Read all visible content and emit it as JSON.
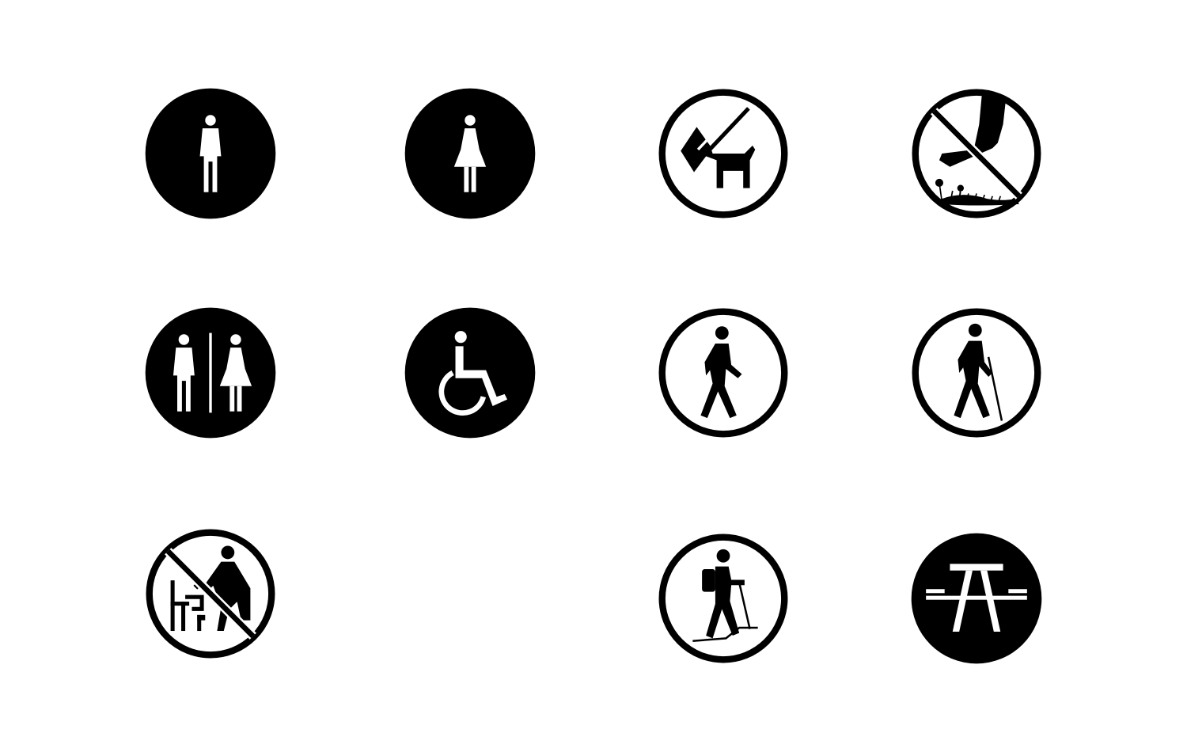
{
  "colors": {
    "sign_fill": "#000000",
    "sign_background": "#ffffff"
  },
  "signs": [
    {
      "icon": "men-restroom-icon",
      "style": "solid"
    },
    {
      "icon": "women-restroom-icon",
      "style": "solid"
    },
    {
      "icon": "no-dogs-icon",
      "style": "prohibition"
    },
    {
      "icon": "keep-off-grass-icon",
      "style": "prohibition"
    },
    {
      "icon": "unisex-restroom-icon",
      "style": "solid"
    },
    {
      "icon": "wheelchair-accessible-icon",
      "style": "solid"
    },
    {
      "icon": "walking-trail-icon",
      "style": "outline"
    },
    {
      "icon": "walking-with-cane-icon",
      "style": "outline"
    },
    {
      "icon": "no-littering-icon",
      "style": "prohibition"
    },
    {
      "icon": "hiking-trail-icon",
      "style": "outline"
    },
    {
      "icon": "picnic-area-icon",
      "style": "solid"
    }
  ]
}
